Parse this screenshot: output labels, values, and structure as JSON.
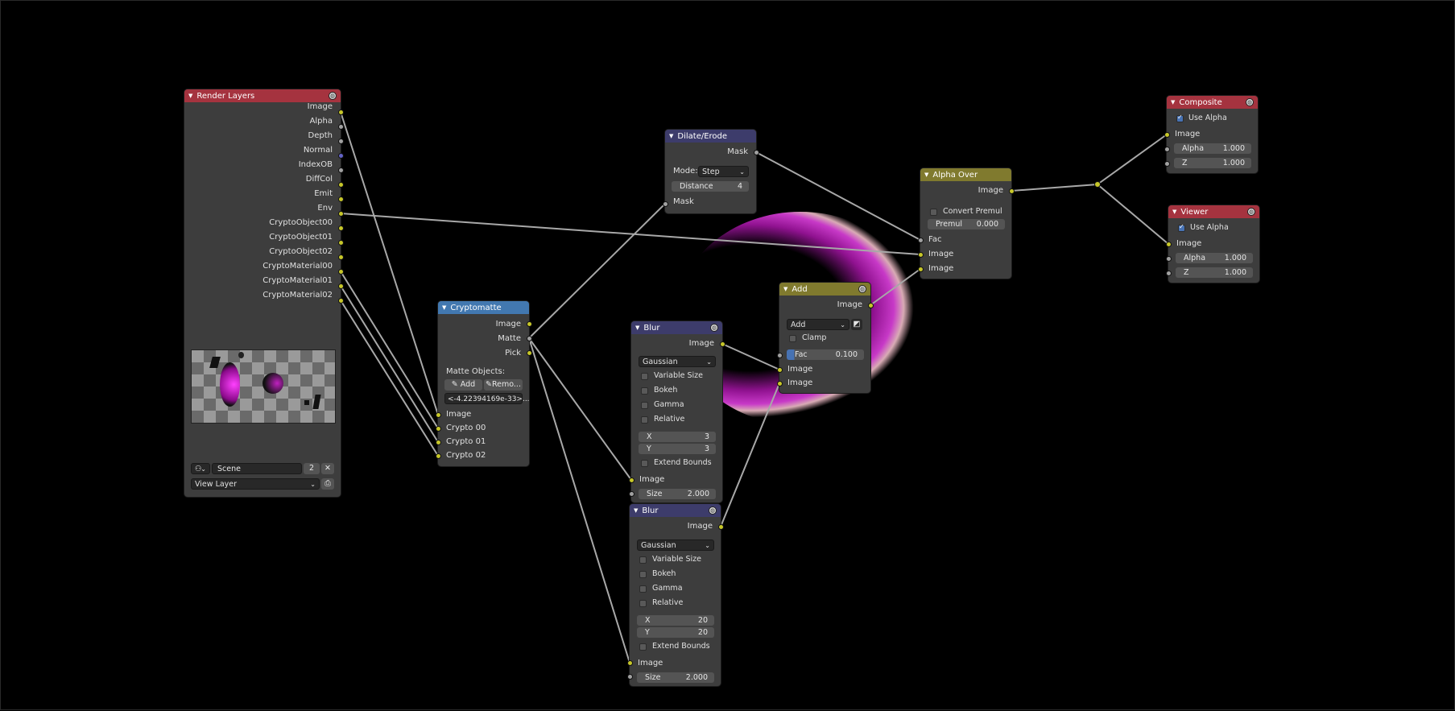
{
  "nodes": {
    "render_layers": {
      "title": "Render Layers",
      "outputs": [
        "Image",
        "Alpha",
        "Depth",
        "Normal",
        "IndexOB",
        "DiffCol",
        "Emit",
        "Env",
        "CryptoObject00",
        "CryptoObject01",
        "CryptoObject02",
        "CryptoMaterial00",
        "CryptoMaterial01",
        "CryptoMaterial02"
      ],
      "scene_label": "Scene",
      "scene_users": "2",
      "view_layer_label": "View Layer"
    },
    "cryptomatte": {
      "title": "Cryptomatte",
      "outputs": [
        "Image",
        "Matte",
        "Pick"
      ],
      "matte_objects_label": "Matte Objects:",
      "add_label": "Add",
      "remove_label": "Remo...",
      "matte_value": "<-4.22394169e-33>...",
      "inputs": [
        "Image",
        "Crypto 00",
        "Crypto 01",
        "Crypto 02"
      ]
    },
    "dilate_erode": {
      "title": "Dilate/Erode",
      "output": "Mask",
      "mode_label": "Mode:",
      "mode_value": "Step",
      "distance_label": "Distance",
      "distance_value": "4",
      "input": "Mask"
    },
    "blur1": {
      "title": "Blur",
      "output": "Image",
      "filter": "Gaussian",
      "options": [
        {
          "label": "Variable Size",
          "checked": false
        },
        {
          "label": "Bokeh",
          "checked": false
        },
        {
          "label": "Gamma",
          "checked": false
        },
        {
          "label": "Relative",
          "checked": false
        }
      ],
      "x_label": "X",
      "x_value": "3",
      "y_label": "Y",
      "y_value": "3",
      "extend_label": "Extend Bounds",
      "input": "Image",
      "size_label": "Size",
      "size_value": "2.000"
    },
    "blur2": {
      "title": "Blur",
      "output": "Image",
      "filter": "Gaussian",
      "options": [
        {
          "label": "Variable Size",
          "checked": false
        },
        {
          "label": "Bokeh",
          "checked": false
        },
        {
          "label": "Gamma",
          "checked": false
        },
        {
          "label": "Relative",
          "checked": false
        }
      ],
      "x_label": "X",
      "x_value": "20",
      "y_label": "Y",
      "y_value": "20",
      "extend_label": "Extend Bounds",
      "input": "Image",
      "size_label": "Size",
      "size_value": "2.000"
    },
    "add": {
      "title": "Add",
      "output": "Image",
      "blend_mode": "Add",
      "clamp_label": "Clamp",
      "fac_label": "Fac",
      "fac_value": "0.100",
      "inputs": [
        "Image",
        "Image"
      ]
    },
    "alpha_over": {
      "title": "Alpha Over",
      "output": "Image",
      "convert_premul_label": "Convert Premul",
      "premul_label": "Premul",
      "premul_value": "0.000",
      "inputs": [
        "Fac",
        "Image",
        "Image"
      ]
    },
    "composite": {
      "title": "Composite",
      "use_alpha_label": "Use Alpha",
      "use_alpha": true,
      "input": "Image",
      "alpha_label": "Alpha",
      "alpha_value": "1.000",
      "z_label": "Z",
      "z_value": "1.000"
    },
    "viewer": {
      "title": "Viewer",
      "use_alpha_label": "Use Alpha",
      "use_alpha": true,
      "input": "Image",
      "alpha_label": "Alpha",
      "alpha_value": "1.000",
      "z_label": "Z",
      "z_value": "1.000"
    }
  },
  "colors": {
    "input_header": "#a5333f",
    "matte_header": "#4278b0",
    "filter_header": "#3d3c6b",
    "color_header": "#807a2e",
    "output_header": "#a5333f",
    "socket_color": "#c7c729",
    "socket_gray": "#a1a1a1",
    "socket_vector": "#6363c7",
    "wire": "#a8a8a8"
  }
}
